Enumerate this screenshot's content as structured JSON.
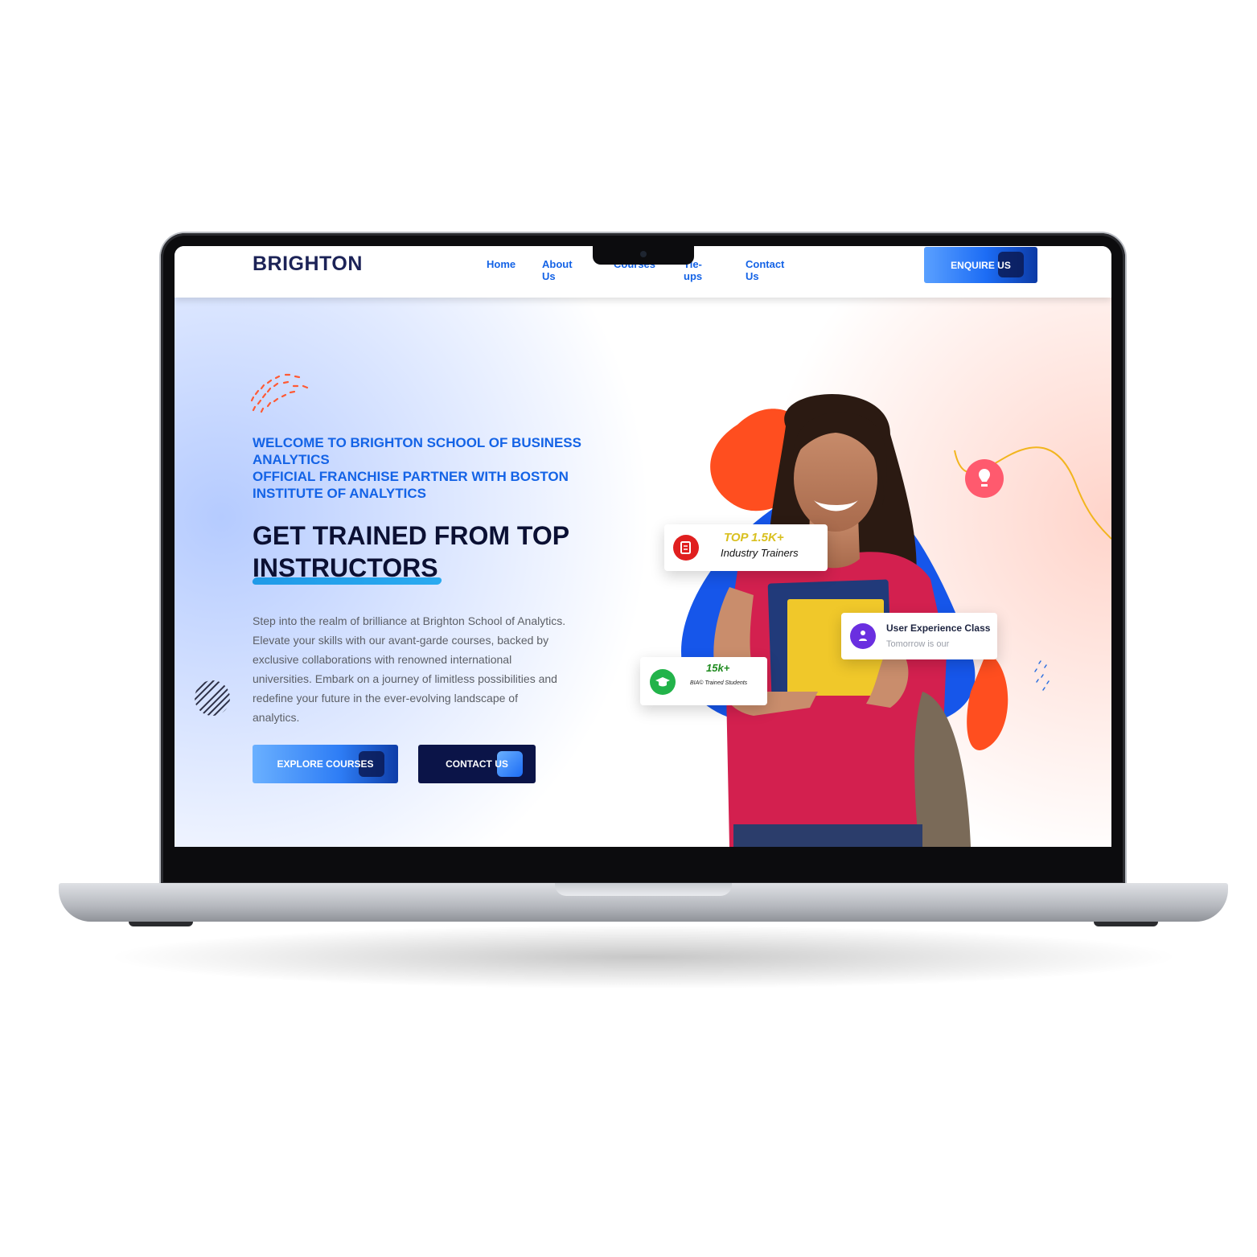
{
  "site": {
    "logo": "BRIGHTON",
    "nav": [
      "Home",
      "About Us",
      "Courses",
      "Tie-ups",
      "Contact Us"
    ],
    "enquire_label": "ENQUIRE US"
  },
  "hero": {
    "welcome_line1": "WELCOME TO BRIGHTON SCHOOL OF BUSINESS ANALYTICS",
    "welcome_line2": "OFFICIAL FRANCHISE PARTNER WITH BOSTON INSTITUTE OF ANALYTICS",
    "headline_line1": "GET TRAINED FROM TOP",
    "headline_line2": "INSTRUCTORS",
    "description": "Step into the realm of brilliance at Brighton School of Analytics. Elevate your skills with our avant-garde courses, backed by exclusive collaborations with renowned international universities. Embark on a journey of limitless possibilities and redefine your future in the ever-evolving landscape of analytics.",
    "explore_label": "EXPLORE COURSES",
    "contact_label": "CONTACT US"
  },
  "cards": {
    "trainers": {
      "value": "TOP 1.5K+",
      "label": "Industry Trainers"
    },
    "ux": {
      "title": "User Experience Class",
      "subtitle": "Tomorrow is our"
    },
    "students": {
      "value": "15k+",
      "label": "BIA© Trained Students"
    }
  },
  "colors": {
    "brand_blue": "#1463e6",
    "navy": "#0b1448",
    "orange": "#ff4e1f",
    "pink": "#d5215a"
  }
}
